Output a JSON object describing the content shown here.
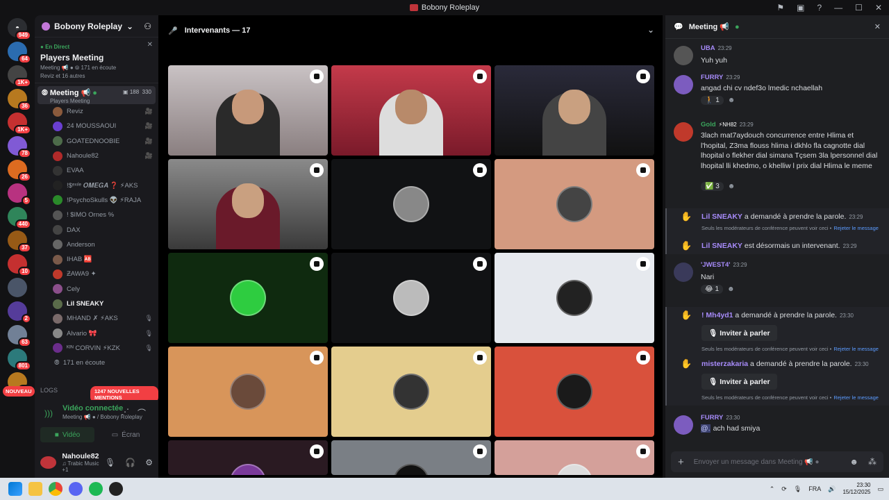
{
  "window": {
    "title": "Bobony Roleplay"
  },
  "servers": {
    "badges": [
      "949",
      "64",
      "1K+",
      "36",
      "1K+",
      "78",
      "26",
      "5",
      "440",
      "37",
      "10",
      "",
      "2",
      "63",
      "801",
      "34"
    ],
    "nouveau": "NOUVEAU",
    "mentions": "1247 NOUVELLES MENTIONS"
  },
  "sidebar": {
    "guild_name": "Bobony Roleplay",
    "live_label": "En Direct",
    "live_title": "Players Meeting",
    "live_meta": "Meeting 📢 ●  ⦾ 171 en écoute",
    "live_participants": "Reviz et 16 autres",
    "active_channel": {
      "name": "Meeting 📢",
      "sub": "Players Meeting",
      "count1": "188",
      "count2": "330"
    },
    "members": [
      {
        "name": "Reviz",
        "color": "#8a5a3c",
        "tag": "🎥"
      },
      {
        "name": "24 MOUSSAOUI",
        "color": "#6a3fd1",
        "tag": "🎥"
      },
      {
        "name": "GOATEDNOOBIE",
        "color": "#4d6b4a",
        "tag": "🎥"
      },
      {
        "name": "Nahoule82",
        "color": "#b02a2a",
        "tag": "🎥"
      },
      {
        "name": "EVAA",
        "color": "#333",
        "tag": ""
      },
      {
        "name": "!$ᵉˣᶦˡᵉ 𝑶𝑴𝑬𝑮𝑨 ❓ ⚡AKS",
        "color": "#222",
        "tag": ""
      },
      {
        "name": "!PsychoSkulls 👽 ⚡RAJA",
        "color": "#2a8a2a",
        "tag": ""
      },
      {
        "name": "! $IMO Ornes %",
        "color": "#555",
        "tag": ""
      },
      {
        "name": "DAX",
        "color": "#444",
        "tag": ""
      },
      {
        "name": "Anderson",
        "color": "#666",
        "tag": ""
      },
      {
        "name": "IHAB 🆎",
        "color": "#7a5a4a",
        "tag": ""
      },
      {
        "name": "ƵAWA9 ✦",
        "color": "#c0392b",
        "tag": ""
      },
      {
        "name": "Cely",
        "color": "#8b4f8b",
        "tag": ""
      },
      {
        "name": "Lil SNEAKY",
        "color": "#5a6b4a",
        "tag": "",
        "bright": true
      },
      {
        "name": "ΜΗΑΝD ✗ ⚡AKS",
        "color": "#7a6a6a",
        "tag": "🎙"
      },
      {
        "name": "Alvario 🎀",
        "color": "#888",
        "tag": "🎙"
      },
      {
        "name": "ᴷᴵᴺ CORVIN ⚡KZK",
        "color": "#6b2d8b",
        "tag": "🎙"
      }
    ],
    "listening": "171 en écoute",
    "logs": "LOGS"
  },
  "voice": {
    "status": "Vidéo connectée",
    "location": "Meeting 📢 ● / Bobony Roleplay",
    "video_btn": "Vidéo",
    "screen_btn": "Écran"
  },
  "user": {
    "name": "Nahoule82",
    "status": "♫ Trabic Music +1"
  },
  "stage": {
    "header": "Intervenants — 17"
  },
  "chat": {
    "title": "Meeting 📢",
    "messages": [
      {
        "author": "UBA",
        "color": "#a78bfa",
        "time": "23:29",
        "text": "Yuh yuh",
        "av": "#555"
      },
      {
        "author": "FURRY",
        "color": "#a78bfa",
        "time": "23:29",
        "text": "angad chi cv ndef3o lmedic nchaellah",
        "av": "#7c5cbf",
        "react": "🚶 1"
      },
      {
        "author": "Gold",
        "color": "#3ba55c",
        "time": "23:29",
        "text": "3lach mat7aydouch concurrence entre Hlima et l'hopital, Z3ma flouss hlima i dkhlo fla cagnotte dial lhopital o flekher dial simana Tçsem 3la lpersonnel dial lhopital lli khedmo, o khelliw l prix dial Hlima le meme",
        "av": "#c0392b",
        "react": "✅ 3",
        "tag": "⚡NH82"
      },
      {
        "author": "'JWEST4'",
        "color": "#a78bfa",
        "time": "23:29",
        "text": "Nari",
        "av": "#3a3a5a",
        "react": "😂 1"
      },
      {
        "author": "FURRY",
        "color": "#a78bfa",
        "time": "23:30",
        "text": "ach had smiya",
        "av": "#7c5cbf",
        "mention": "@."
      }
    ],
    "system": [
      {
        "name": "Lil SNEAKY",
        "text": " a demandé à prendre la parole.",
        "time": "23:29"
      },
      {
        "name": "Lil SNEAKY",
        "text": " est désormais un intervenant.",
        "time": "23:29"
      },
      {
        "name": "! Mh4yd1",
        "text": " a demandé à prendre la parole.",
        "time": "23:30"
      },
      {
        "name": "misterzakaria",
        "text": " a demandé à prendre la parole.",
        "time": "23:30"
      }
    ],
    "mod_note": "Seuls les modérateurs de conférence peuvent voir ceci •",
    "mod_link": "Rejeter le message",
    "invite_label": "Inviter à parler",
    "placeholder": "Envoyer un message dans Meeting 📢 ●"
  },
  "taskbar": {
    "lang": "FRA",
    "time": "23:30",
    "date": "15/12/2025"
  }
}
